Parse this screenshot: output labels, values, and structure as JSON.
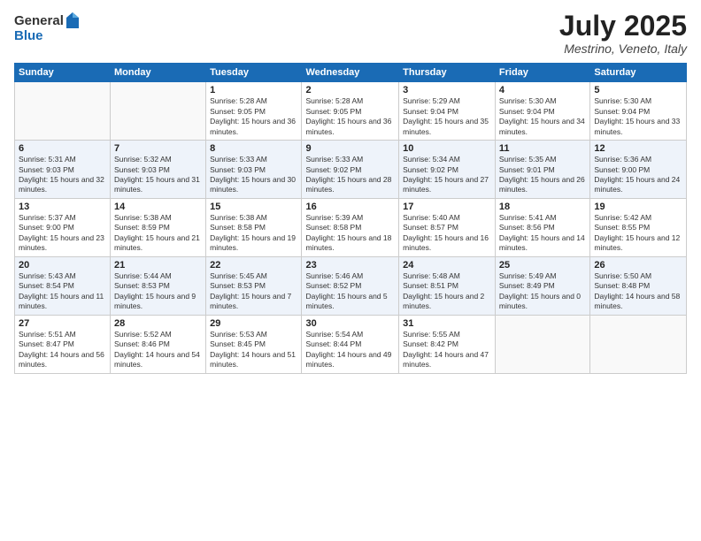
{
  "header": {
    "logo_general": "General",
    "logo_blue": "Blue",
    "title": "July 2025",
    "location": "Mestrino, Veneto, Italy"
  },
  "weekdays": [
    "Sunday",
    "Monday",
    "Tuesday",
    "Wednesday",
    "Thursday",
    "Friday",
    "Saturday"
  ],
  "weeks": [
    [
      {
        "day": "",
        "sunrise": "",
        "sunset": "",
        "daylight": ""
      },
      {
        "day": "",
        "sunrise": "",
        "sunset": "",
        "daylight": ""
      },
      {
        "day": "1",
        "sunrise": "Sunrise: 5:28 AM",
        "sunset": "Sunset: 9:05 PM",
        "daylight": "Daylight: 15 hours and 36 minutes."
      },
      {
        "day": "2",
        "sunrise": "Sunrise: 5:28 AM",
        "sunset": "Sunset: 9:05 PM",
        "daylight": "Daylight: 15 hours and 36 minutes."
      },
      {
        "day": "3",
        "sunrise": "Sunrise: 5:29 AM",
        "sunset": "Sunset: 9:04 PM",
        "daylight": "Daylight: 15 hours and 35 minutes."
      },
      {
        "day": "4",
        "sunrise": "Sunrise: 5:30 AM",
        "sunset": "Sunset: 9:04 PM",
        "daylight": "Daylight: 15 hours and 34 minutes."
      },
      {
        "day": "5",
        "sunrise": "Sunrise: 5:30 AM",
        "sunset": "Sunset: 9:04 PM",
        "daylight": "Daylight: 15 hours and 33 minutes."
      }
    ],
    [
      {
        "day": "6",
        "sunrise": "Sunrise: 5:31 AM",
        "sunset": "Sunset: 9:03 PM",
        "daylight": "Daylight: 15 hours and 32 minutes."
      },
      {
        "day": "7",
        "sunrise": "Sunrise: 5:32 AM",
        "sunset": "Sunset: 9:03 PM",
        "daylight": "Daylight: 15 hours and 31 minutes."
      },
      {
        "day": "8",
        "sunrise": "Sunrise: 5:33 AM",
        "sunset": "Sunset: 9:03 PM",
        "daylight": "Daylight: 15 hours and 30 minutes."
      },
      {
        "day": "9",
        "sunrise": "Sunrise: 5:33 AM",
        "sunset": "Sunset: 9:02 PM",
        "daylight": "Daylight: 15 hours and 28 minutes."
      },
      {
        "day": "10",
        "sunrise": "Sunrise: 5:34 AM",
        "sunset": "Sunset: 9:02 PM",
        "daylight": "Daylight: 15 hours and 27 minutes."
      },
      {
        "day": "11",
        "sunrise": "Sunrise: 5:35 AM",
        "sunset": "Sunset: 9:01 PM",
        "daylight": "Daylight: 15 hours and 26 minutes."
      },
      {
        "day": "12",
        "sunrise": "Sunrise: 5:36 AM",
        "sunset": "Sunset: 9:00 PM",
        "daylight": "Daylight: 15 hours and 24 minutes."
      }
    ],
    [
      {
        "day": "13",
        "sunrise": "Sunrise: 5:37 AM",
        "sunset": "Sunset: 9:00 PM",
        "daylight": "Daylight: 15 hours and 23 minutes."
      },
      {
        "day": "14",
        "sunrise": "Sunrise: 5:38 AM",
        "sunset": "Sunset: 8:59 PM",
        "daylight": "Daylight: 15 hours and 21 minutes."
      },
      {
        "day": "15",
        "sunrise": "Sunrise: 5:38 AM",
        "sunset": "Sunset: 8:58 PM",
        "daylight": "Daylight: 15 hours and 19 minutes."
      },
      {
        "day": "16",
        "sunrise": "Sunrise: 5:39 AM",
        "sunset": "Sunset: 8:58 PM",
        "daylight": "Daylight: 15 hours and 18 minutes."
      },
      {
        "day": "17",
        "sunrise": "Sunrise: 5:40 AM",
        "sunset": "Sunset: 8:57 PM",
        "daylight": "Daylight: 15 hours and 16 minutes."
      },
      {
        "day": "18",
        "sunrise": "Sunrise: 5:41 AM",
        "sunset": "Sunset: 8:56 PM",
        "daylight": "Daylight: 15 hours and 14 minutes."
      },
      {
        "day": "19",
        "sunrise": "Sunrise: 5:42 AM",
        "sunset": "Sunset: 8:55 PM",
        "daylight": "Daylight: 15 hours and 12 minutes."
      }
    ],
    [
      {
        "day": "20",
        "sunrise": "Sunrise: 5:43 AM",
        "sunset": "Sunset: 8:54 PM",
        "daylight": "Daylight: 15 hours and 11 minutes."
      },
      {
        "day": "21",
        "sunrise": "Sunrise: 5:44 AM",
        "sunset": "Sunset: 8:53 PM",
        "daylight": "Daylight: 15 hours and 9 minutes."
      },
      {
        "day": "22",
        "sunrise": "Sunrise: 5:45 AM",
        "sunset": "Sunset: 8:53 PM",
        "daylight": "Daylight: 15 hours and 7 minutes."
      },
      {
        "day": "23",
        "sunrise": "Sunrise: 5:46 AM",
        "sunset": "Sunset: 8:52 PM",
        "daylight": "Daylight: 15 hours and 5 minutes."
      },
      {
        "day": "24",
        "sunrise": "Sunrise: 5:48 AM",
        "sunset": "Sunset: 8:51 PM",
        "daylight": "Daylight: 15 hours and 2 minutes."
      },
      {
        "day": "25",
        "sunrise": "Sunrise: 5:49 AM",
        "sunset": "Sunset: 8:49 PM",
        "daylight": "Daylight: 15 hours and 0 minutes."
      },
      {
        "day": "26",
        "sunrise": "Sunrise: 5:50 AM",
        "sunset": "Sunset: 8:48 PM",
        "daylight": "Daylight: 14 hours and 58 minutes."
      }
    ],
    [
      {
        "day": "27",
        "sunrise": "Sunrise: 5:51 AM",
        "sunset": "Sunset: 8:47 PM",
        "daylight": "Daylight: 14 hours and 56 minutes."
      },
      {
        "day": "28",
        "sunrise": "Sunrise: 5:52 AM",
        "sunset": "Sunset: 8:46 PM",
        "daylight": "Daylight: 14 hours and 54 minutes."
      },
      {
        "day": "29",
        "sunrise": "Sunrise: 5:53 AM",
        "sunset": "Sunset: 8:45 PM",
        "daylight": "Daylight: 14 hours and 51 minutes."
      },
      {
        "day": "30",
        "sunrise": "Sunrise: 5:54 AM",
        "sunset": "Sunset: 8:44 PM",
        "daylight": "Daylight: 14 hours and 49 minutes."
      },
      {
        "day": "31",
        "sunrise": "Sunrise: 5:55 AM",
        "sunset": "Sunset: 8:42 PM",
        "daylight": "Daylight: 14 hours and 47 minutes."
      },
      {
        "day": "",
        "sunrise": "",
        "sunset": "",
        "daylight": ""
      },
      {
        "day": "",
        "sunrise": "",
        "sunset": "",
        "daylight": ""
      }
    ]
  ]
}
